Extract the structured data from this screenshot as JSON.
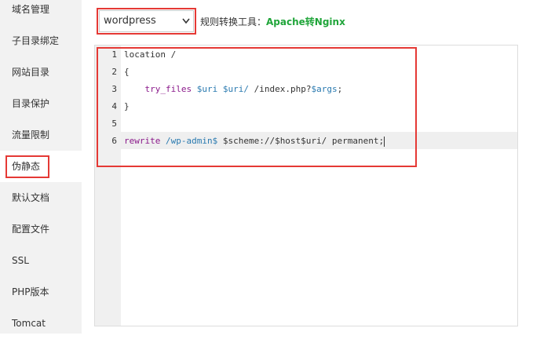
{
  "sidebar": {
    "items": [
      {
        "label": "域名管理"
      },
      {
        "label": "子目录绑定"
      },
      {
        "label": "网站目录"
      },
      {
        "label": "目录保护"
      },
      {
        "label": "流量限制"
      },
      {
        "label": "伪静态"
      },
      {
        "label": "默认文档"
      },
      {
        "label": "配置文件"
      },
      {
        "label": "SSL"
      },
      {
        "label": "PHP版本"
      },
      {
        "label": "Tomcat"
      }
    ],
    "active": "伪静态"
  },
  "rewrite": {
    "selected": "wordpress",
    "tool_label": "规则转换工具：",
    "tool_link": "Apache转Nginx"
  },
  "editor": {
    "line_numbers": [
      "1",
      "2",
      "3",
      "4",
      "5",
      "6"
    ],
    "lines": {
      "l1": "location /",
      "l2": "{",
      "l3_kw": "try_files",
      "l3_v1": "$uri",
      "l3_v2": "$uri/",
      "l3_p1": " /index.php?",
      "l3_v3": "$args",
      "l3_p2": ";",
      "l4": "}",
      "l6_kw": "rewrite",
      "l6_re": "/wp-admin$",
      "l6_p": " $scheme://$host$uri/ permanent;"
    }
  },
  "colors": {
    "highlight_red": "#e53935",
    "link_green": "#20a53a",
    "keyword": "#8b1a8b",
    "variable": "#2a7ab0"
  }
}
